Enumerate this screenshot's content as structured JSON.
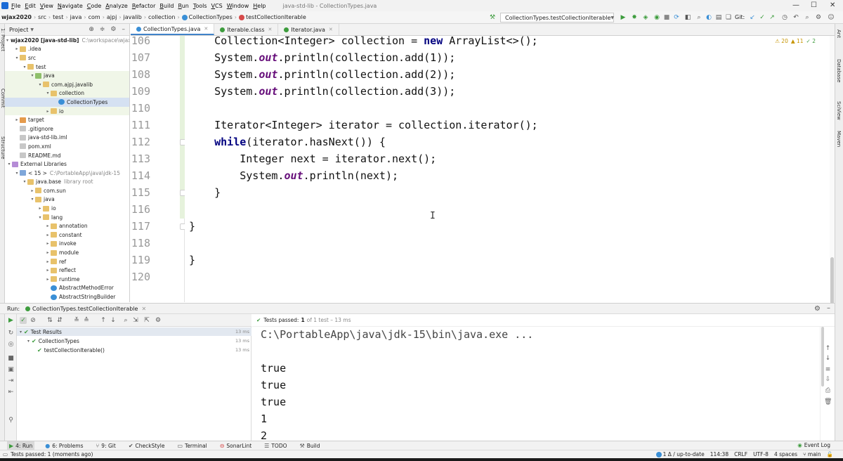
{
  "menubar": {
    "items": [
      "File",
      "Edit",
      "View",
      "Navigate",
      "Code",
      "Analyze",
      "Refactor",
      "Build",
      "Run",
      "Tools",
      "VCS",
      "Window",
      "Help"
    ],
    "window_title": "java-std-lib - CollectionTypes.java",
    "controls": [
      "—",
      "☐",
      "✕"
    ]
  },
  "navbar": {
    "crumbs": [
      "wjax2020",
      "src",
      "test",
      "java",
      "com",
      "ajpj",
      "javalib",
      "collection",
      "CollectionTypes",
      "testCollectionIterable"
    ],
    "run_config": "CollectionTypes.testCollectionIterable",
    "git_label": "Git:"
  },
  "left_strip": {
    "project_label": "1: Project",
    "structure_label": "Structure",
    "commit_label": "Commit"
  },
  "right_strip": {
    "ant": "Ant",
    "database": "Database",
    "sciview": "SciView",
    "maven": "Maven"
  },
  "project": {
    "title": "Project",
    "tree": [
      {
        "label": "wjax2020 [java-std-lib]",
        "extra": "C:\\workspace\\wjax",
        "level": 0,
        "arrow": "▾",
        "icon": "folder",
        "bold": true
      },
      {
        "label": ".idea",
        "level": 1,
        "arrow": "▸",
        "icon": "folder"
      },
      {
        "label": "src",
        "level": 1,
        "arrow": "▾",
        "icon": "folder"
      },
      {
        "label": "test",
        "level": 2,
        "arrow": "▾",
        "icon": "folder"
      },
      {
        "label": "java",
        "level": 3,
        "arrow": "▾",
        "icon": "folder green",
        "green": true
      },
      {
        "label": "com.ajpj.javalib",
        "level": 4,
        "arrow": "▾",
        "icon": "folder",
        "green": true
      },
      {
        "label": "collection",
        "level": 5,
        "arrow": "▾",
        "icon": "folder",
        "green": true
      },
      {
        "label": "CollectionTypes",
        "level": 6,
        "arrow": "",
        "icon": "class-ic",
        "selected": true
      },
      {
        "label": "io",
        "level": 5,
        "arrow": "▸",
        "icon": "folder",
        "green": true
      },
      {
        "label": "target",
        "level": 1,
        "arrow": "▸",
        "icon": "folder orange"
      },
      {
        "label": ".gitignore",
        "level": 1,
        "arrow": "",
        "icon": "file-ic"
      },
      {
        "label": "java-std-lib.iml",
        "level": 1,
        "arrow": "",
        "icon": "file-ic"
      },
      {
        "label": "pom.xml",
        "level": 1,
        "arrow": "",
        "icon": "file-ic"
      },
      {
        "label": "README.md",
        "level": 1,
        "arrow": "",
        "icon": "file-ic"
      },
      {
        "label": "External Libraries",
        "level": 0,
        "arrow": "▾",
        "icon": "lib-ic"
      },
      {
        "label": "< 15 >",
        "extra": "C:\\PortableApp\\java\\jdk-15",
        "level": 1,
        "arrow": "▾",
        "icon": "folder blue"
      },
      {
        "label": "java.base",
        "extra": "library root",
        "level": 2,
        "arrow": "▾",
        "icon": "folder"
      },
      {
        "label": "com.sun",
        "level": 3,
        "arrow": "▸",
        "icon": "folder"
      },
      {
        "label": "java",
        "level": 3,
        "arrow": "▾",
        "icon": "folder"
      },
      {
        "label": "io",
        "level": 4,
        "arrow": "▸",
        "icon": "folder"
      },
      {
        "label": "lang",
        "level": 4,
        "arrow": "▾",
        "icon": "folder"
      },
      {
        "label": "annotation",
        "level": 5,
        "arrow": "▸",
        "icon": "folder"
      },
      {
        "label": "constant",
        "level": 5,
        "arrow": "▸",
        "icon": "folder"
      },
      {
        "label": "invoke",
        "level": 5,
        "arrow": "▸",
        "icon": "folder"
      },
      {
        "label": "module",
        "level": 5,
        "arrow": "▸",
        "icon": "folder"
      },
      {
        "label": "ref",
        "level": 5,
        "arrow": "▸",
        "icon": "folder"
      },
      {
        "label": "reflect",
        "level": 5,
        "arrow": "▸",
        "icon": "folder"
      },
      {
        "label": "runtime",
        "level": 5,
        "arrow": "▸",
        "icon": "folder"
      },
      {
        "label": "AbstractMethodError",
        "level": 5,
        "arrow": "",
        "icon": "class-ic"
      },
      {
        "label": "AbstractStringBuilder",
        "level": 5,
        "arrow": "",
        "icon": "class-ic"
      }
    ]
  },
  "editor_tabs": [
    {
      "label": "CollectionTypes.java",
      "active": true,
      "color": "#3a8fd6"
    },
    {
      "label": "Iterable.class",
      "active": false,
      "color": "#3d9c3d"
    },
    {
      "label": "Iterator.java",
      "active": false,
      "color": "#3d9c3d"
    }
  ],
  "editor": {
    "warnings": {
      "warn": "⚠ 20",
      "weak": "▲ 11",
      "typo": "✓ 2"
    },
    "lines": [
      {
        "no": "106",
        "html": "    Collection&lt;Integer&gt; collection = <span class='kw'>new</span> ArrayList&lt;&gt;();"
      },
      {
        "no": "107",
        "html": "    System.<span class='st'>out</span>.println(collection.add(1));"
      },
      {
        "no": "108",
        "html": "    System.<span class='st'>out</span>.println(collection.add(2));"
      },
      {
        "no": "109",
        "html": "    System.<span class='st'>out</span>.println(collection.add(3));"
      },
      {
        "no": "110",
        "html": ""
      },
      {
        "no": "111",
        "html": "    Iterator&lt;Integer&gt; iterator = collection.iterator();"
      },
      {
        "no": "112",
        "html": "    <span class='kw'>while</span>(iterator.hasNext()) {"
      },
      {
        "no": "113",
        "html": "        Integer next = iterator.next();"
      },
      {
        "no": "114",
        "html": "        System.<span class='st'>out</span>.println(next);"
      },
      {
        "no": "115",
        "html": "    }"
      },
      {
        "no": "116",
        "html": ""
      },
      {
        "no": "117",
        "html": "}"
      },
      {
        "no": "118",
        "html": ""
      },
      {
        "no": "119",
        "html": "}"
      },
      {
        "no": "120",
        "html": ""
      }
    ]
  },
  "run_panel": {
    "label": "Run:",
    "tab": "CollectionTypes.testCollectionIterable",
    "status_prefix": "Tests passed:",
    "status_count": "1",
    "status_suffix": "of 1 test – 13 ms",
    "tests": [
      {
        "label": "Test Results",
        "time": "13 ms",
        "level": 0,
        "arrow": "▾"
      },
      {
        "label": "CollectionTypes",
        "time": "13 ms",
        "level": 1,
        "arrow": "▾"
      },
      {
        "label": "testCollectionIterable()",
        "time": "13 ms",
        "level": 2,
        "arrow": ""
      }
    ],
    "console": [
      "C:\\PortableApp\\java\\jdk-15\\bin\\java.exe ...",
      "",
      "true",
      "true",
      "true",
      "1",
      "2"
    ]
  },
  "tool_strip": {
    "items": [
      {
        "icon": "▶",
        "label": "4: Run",
        "active": true
      },
      {
        "icon": "●",
        "label": "6: Problems"
      },
      {
        "icon": "⑂",
        "label": "9: Git"
      },
      {
        "icon": "✔",
        "label": "CheckStyle"
      },
      {
        "icon": "▭",
        "label": "Terminal"
      },
      {
        "icon": "⊖",
        "label": "SonarLint"
      },
      {
        "icon": "☰",
        "label": "TODO"
      },
      {
        "icon": "⚒",
        "label": "Build"
      }
    ],
    "event_log": "Event Log"
  },
  "statusbar": {
    "message": "Tests passed: 1 (moments ago)",
    "vcs": "1 Δ / up-to-date",
    "position": "114:38",
    "line_sep": "CRLF",
    "encoding": "UTF-8",
    "indent": "4 spaces",
    "branch": "main"
  }
}
